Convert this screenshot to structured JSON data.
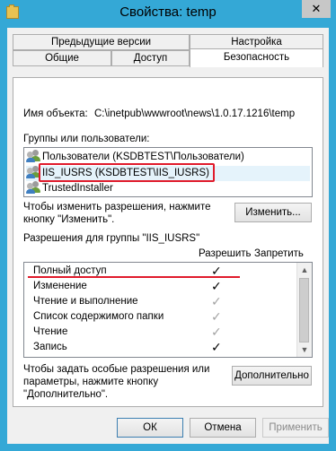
{
  "window": {
    "title": "Свойства: temp",
    "close_glyph": "✕"
  },
  "tabs": {
    "row1": [
      "Предыдущие версии",
      "Настройка"
    ],
    "row2": [
      "Общие",
      "Доступ",
      "Безопасность"
    ],
    "active": "Безопасность"
  },
  "object": {
    "label": "Имя объекта:",
    "value": "C:\\inetpub\\wwwroot\\news\\1.0.17.1216\\temp"
  },
  "groups": {
    "label": "Группы или пользователи:",
    "items": [
      "Пользователи (KSDBTEST\\Пользователи)",
      "IIS_IUSRS (KSDBTEST\\IIS_IUSRS)",
      "TrustedInstaller"
    ],
    "selected_index": 1
  },
  "change_hint": "Чтобы изменить разрешения, нажмите кнопку \"Изменить\".",
  "change_button": "Изменить...",
  "permissions": {
    "header": "Разрешения для группы \"IIS_IUSRS\"",
    "allow_label": "Разрешить",
    "deny_label": "Запретить",
    "rows": [
      {
        "name": "Полный доступ",
        "allow": "✓",
        "state": "explicit"
      },
      {
        "name": "Изменение",
        "allow": "✓",
        "state": "explicit"
      },
      {
        "name": "Чтение и выполнение",
        "allow": "✓",
        "state": "inherited"
      },
      {
        "name": "Список содержимого папки",
        "allow": "✓",
        "state": "inherited"
      },
      {
        "name": "Чтение",
        "allow": "✓",
        "state": "inherited"
      },
      {
        "name": "Запись",
        "allow": "✓",
        "state": "explicit"
      }
    ]
  },
  "special_hint": "Чтобы задать особые разрешения или параметры, нажмите кнопку \"Дополнительно\".",
  "advanced_button": "Дополнительно",
  "footer": {
    "ok": "ОК",
    "cancel": "Отмена",
    "apply": "Применить"
  },
  "colors": {
    "annotation_red": "#e01a2b",
    "title_bar": "#34a8d6"
  }
}
